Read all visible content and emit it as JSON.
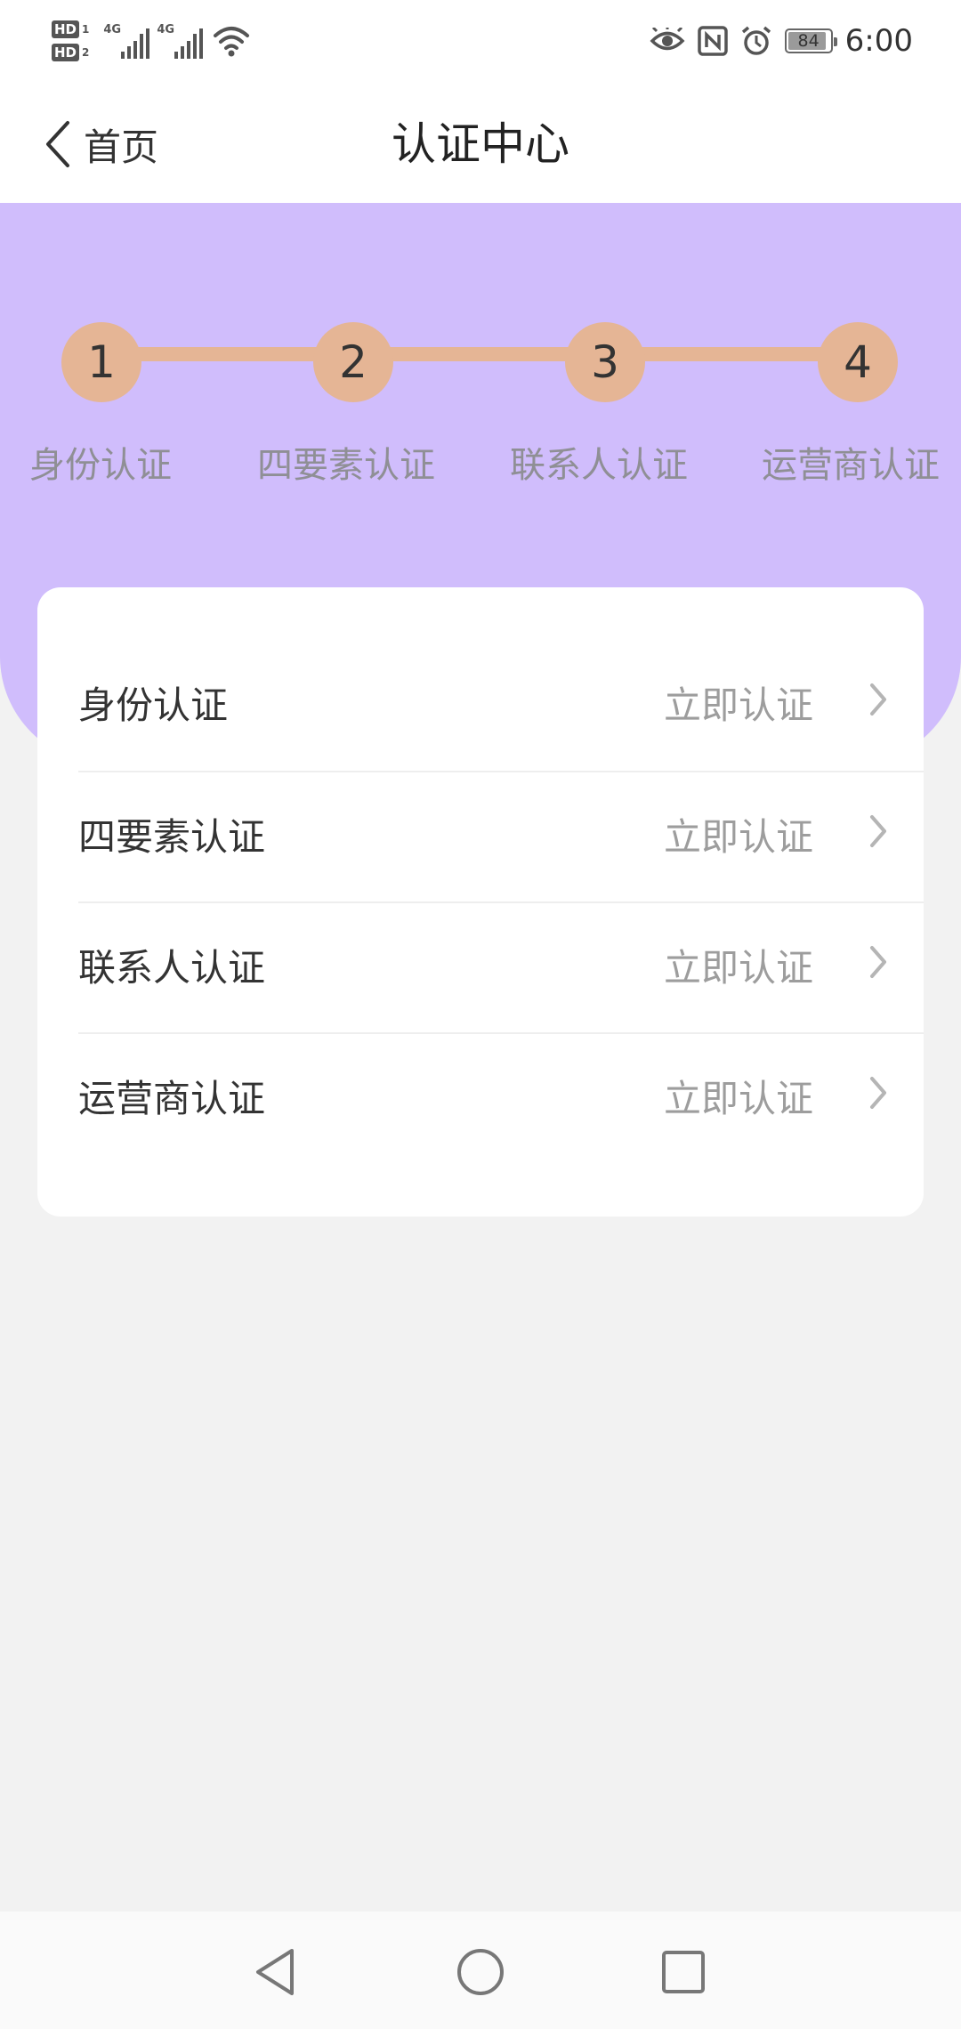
{
  "status_bar": {
    "sim1_label": "HD",
    "sim1_num": "1",
    "sim2_label": "HD",
    "sim2_num": "2",
    "net1": "4G",
    "net2": "4G",
    "battery": "84",
    "time": "6:00",
    "icons": [
      "wifi-icon",
      "eye-icon",
      "nfc-icon",
      "alarm-icon",
      "battery-icon"
    ]
  },
  "nav": {
    "back_label": "首页",
    "title": "认证中心"
  },
  "steps": [
    {
      "number": "1",
      "label": "身份认证"
    },
    {
      "number": "2",
      "label": "四要素认证"
    },
    {
      "number": "3",
      "label": "联系人认证"
    },
    {
      "number": "4",
      "label": "运营商认证"
    }
  ],
  "items": [
    {
      "name": "身份认证",
      "action": "立即认证"
    },
    {
      "name": "四要素认证",
      "action": "立即认证"
    },
    {
      "name": "联系人认证",
      "action": "立即认证"
    },
    {
      "name": "运营商认证",
      "action": "立即认证"
    }
  ],
  "colors": {
    "hero": "#d0bdfc",
    "step": "#e5b595",
    "background": "#f2f2f2"
  }
}
